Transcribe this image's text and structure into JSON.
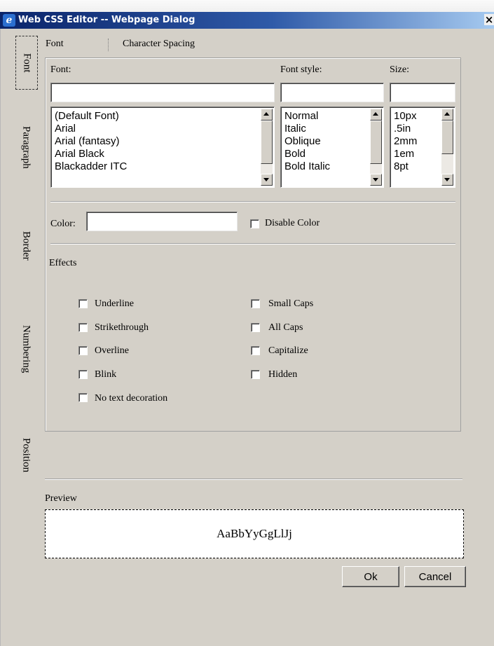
{
  "window": {
    "title": "Web CSS Editor -- Webpage Dialog",
    "close_glyph": "×"
  },
  "side_tabs": [
    "Font",
    "Paragraph",
    "Border",
    "Numbering",
    "Position"
  ],
  "top_tabs": [
    "Font",
    "Character Spacing"
  ],
  "font": {
    "font_label": "Font:",
    "style_label": "Font style:",
    "size_label": "Size:",
    "font_value": "",
    "style_value": "",
    "size_value": "",
    "font_list": [
      "(Default Font)",
      "Arial",
      "Arial (fantasy)",
      "Arial Black",
      "Blackadder ITC"
    ],
    "style_list": [
      "Normal",
      "Italic",
      "Oblique",
      "Bold",
      "Bold Italic"
    ],
    "size_list": [
      "10px",
      ".5in",
      "2mm",
      "1em",
      "8pt"
    ]
  },
  "color": {
    "label": "Color:",
    "value": "",
    "disable_label": "Disable Color",
    "disable_checked": false
  },
  "effects": {
    "heading": "Effects",
    "left": [
      "Underline",
      "Strikethrough",
      "Overline",
      "Blink",
      "No text decoration"
    ],
    "right": [
      "Small Caps",
      "All Caps",
      "Capitalize",
      "Hidden"
    ]
  },
  "preview": {
    "label": "Preview",
    "sample": "AaBbYyGgLlJj"
  },
  "buttons": {
    "ok": "Ok",
    "cancel": "Cancel"
  },
  "colors": {
    "title_gradient_start": "#0a246a",
    "dialog_bg": "#d4d0c8"
  }
}
